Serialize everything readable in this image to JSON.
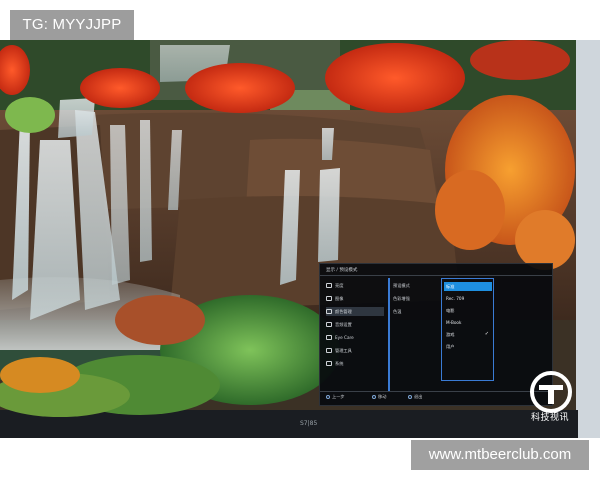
{
  "watermarks": {
    "top": "TG: MYYJJPP",
    "bottom": "www.mtbeerclub.com"
  },
  "monitor": {
    "bezel_label": "S7|85",
    "logo_text": "科技视讯"
  },
  "osd": {
    "title": "显示 / 预设模式",
    "menu": [
      {
        "label": "亮度",
        "icon": "sun-icon"
      },
      {
        "label": "图像",
        "icon": "image-icon"
      },
      {
        "label": "颜色管理",
        "icon": "color-icon"
      },
      {
        "label": "音频设置",
        "icon": "audio-icon"
      },
      {
        "label": "Eye Care",
        "icon": "eye-icon"
      },
      {
        "label": "管理工具",
        "icon": "person-icon"
      },
      {
        "label": "系统",
        "icon": "system-icon"
      }
    ],
    "submenu": [
      {
        "label": "预设模式"
      },
      {
        "label": "色彩增强"
      },
      {
        "label": "色温"
      }
    ],
    "options": [
      {
        "label": "标准",
        "selected": false
      },
      {
        "label": "Rec. 709",
        "selected": false
      },
      {
        "label": "电影",
        "selected": false
      },
      {
        "label": "M-Book",
        "selected": false
      },
      {
        "label": "游戏",
        "selected": true
      },
      {
        "label": "用户",
        "selected": false
      }
    ],
    "footer": {
      "prev": "上一步",
      "move": "移动",
      "exit": "退出"
    }
  },
  "colors": {
    "accent": "#1e8fe0",
    "osd_bg": "#080a0e"
  }
}
